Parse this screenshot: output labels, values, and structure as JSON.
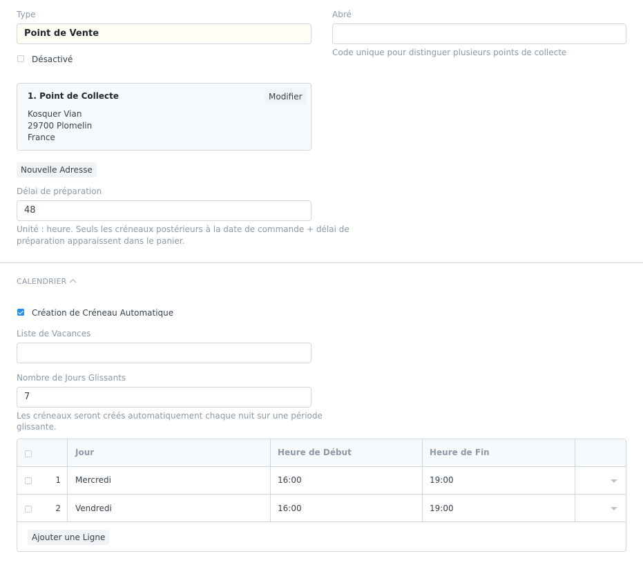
{
  "left": {
    "type_label": "Type",
    "type_value": "Point de Vente",
    "disabled_label": "Désactivé",
    "address": {
      "title": "1. Point de Collecte",
      "edit_label": "Modifier",
      "line1": "Kosquer Vian",
      "line2": "29700 Plomelin",
      "line3": "France"
    },
    "new_address_label": "Nouvelle Adresse",
    "prep_label": "Délai de préparation",
    "prep_value": "48",
    "prep_help_1": "Unité : heure. Seuls les créneaux postérieurs à la date de commande + délai de",
    "prep_help_2": "préparation apparaissent dans le panier."
  },
  "right": {
    "abbr_label": "Abré",
    "abbr_value": "",
    "abbr_help": "Code unique pour distinguer plusieurs points de collecte"
  },
  "calendar": {
    "section_title": "CALENDRIER",
    "auto_label": "Création de Créneau Automatique",
    "auto_checked": true,
    "holidays_label": "Liste de Vacances",
    "holidays_value": "",
    "days_label": "Nombre de Jours Glissants",
    "days_value": "7",
    "days_help_1": "Les créneaux seront créés automatiquement chaque nuit sur une période",
    "days_help_2": "glissante."
  },
  "table": {
    "headers": {
      "day": "Jour",
      "start": "Heure de Début",
      "end": "Heure de Fin"
    },
    "rows": [
      {
        "idx": "1",
        "day": "Mercredi",
        "start": "16:00",
        "end": "19:00"
      },
      {
        "idx": "2",
        "day": "Vendredi",
        "start": "16:00",
        "end": "19:00"
      }
    ],
    "add_row_label": "Ajouter une Ligne"
  }
}
